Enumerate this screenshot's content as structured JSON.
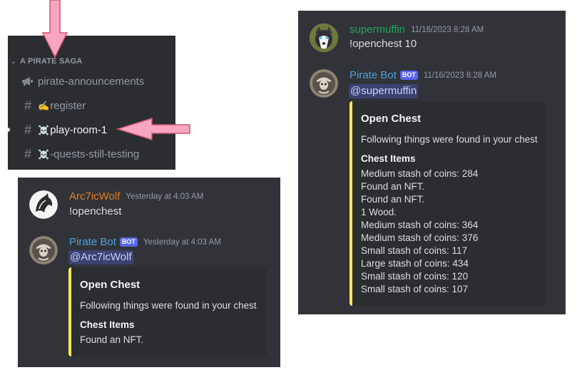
{
  "sidebar": {
    "category": "A PIRATE SAGA",
    "channels": [
      {
        "prefix_icon": "megaphone-icon",
        "emoji": "",
        "label": "pirate-announcements",
        "active": false
      },
      {
        "prefix_icon": "hash-icon",
        "emoji": "✍️",
        "label": "register",
        "active": false
      },
      {
        "prefix_icon": "hash-icon",
        "emoji": "☠️",
        "label": "play-room-1",
        "active": true
      },
      {
        "prefix_icon": "hash-icon",
        "emoji": "☠️",
        "label": "-quests-still-testing",
        "active": false
      }
    ]
  },
  "chat_right": {
    "user_message": {
      "username": "supermuffin",
      "username_color": "#23a55a",
      "timestamp": "11/16/2023 8:28 AM",
      "content": "!openchest 10"
    },
    "bot_message": {
      "username": "Pirate Bot",
      "username_color": "#4aa3df",
      "bot_tag": "BOT",
      "timestamp": "11/16/2023 8:28 AM",
      "mention": "@supermuffin",
      "embed": {
        "accent": "#fee75c",
        "title": "Open Chest",
        "description": "Following things were found in your chest",
        "field_name": "Chest Items",
        "items": [
          "Medium stash of coins: 284",
          "Found an NFT.",
          "Found an NFT.",
          "1 Wood.",
          "Medium stash of coins: 364",
          "Medium stash of coins: 376",
          "Small stash of coins: 117",
          "Large stash of coins: 434",
          "Small stash of coins: 120",
          "Small stash of coins: 107"
        ]
      }
    }
  },
  "chat_left": {
    "user_message": {
      "username": "Arc7icWolf",
      "username_color": "#e67e22",
      "timestamp": "Yesterday at 4:03 AM",
      "content": "!openchest"
    },
    "bot_message": {
      "username": "Pirate Bot",
      "username_color": "#4aa3df",
      "bot_tag": "BOT",
      "timestamp": "Yesterday at 4:03 AM",
      "mention": "@Arc7icWolf",
      "embed": {
        "accent": "#fee75c",
        "title": "Open Chest",
        "description": "Following things were found in your chest",
        "field_name": "Chest Items",
        "items": [
          "Found an NFT."
        ]
      }
    }
  },
  "annotation_arrow_color": "#f8a5c2"
}
